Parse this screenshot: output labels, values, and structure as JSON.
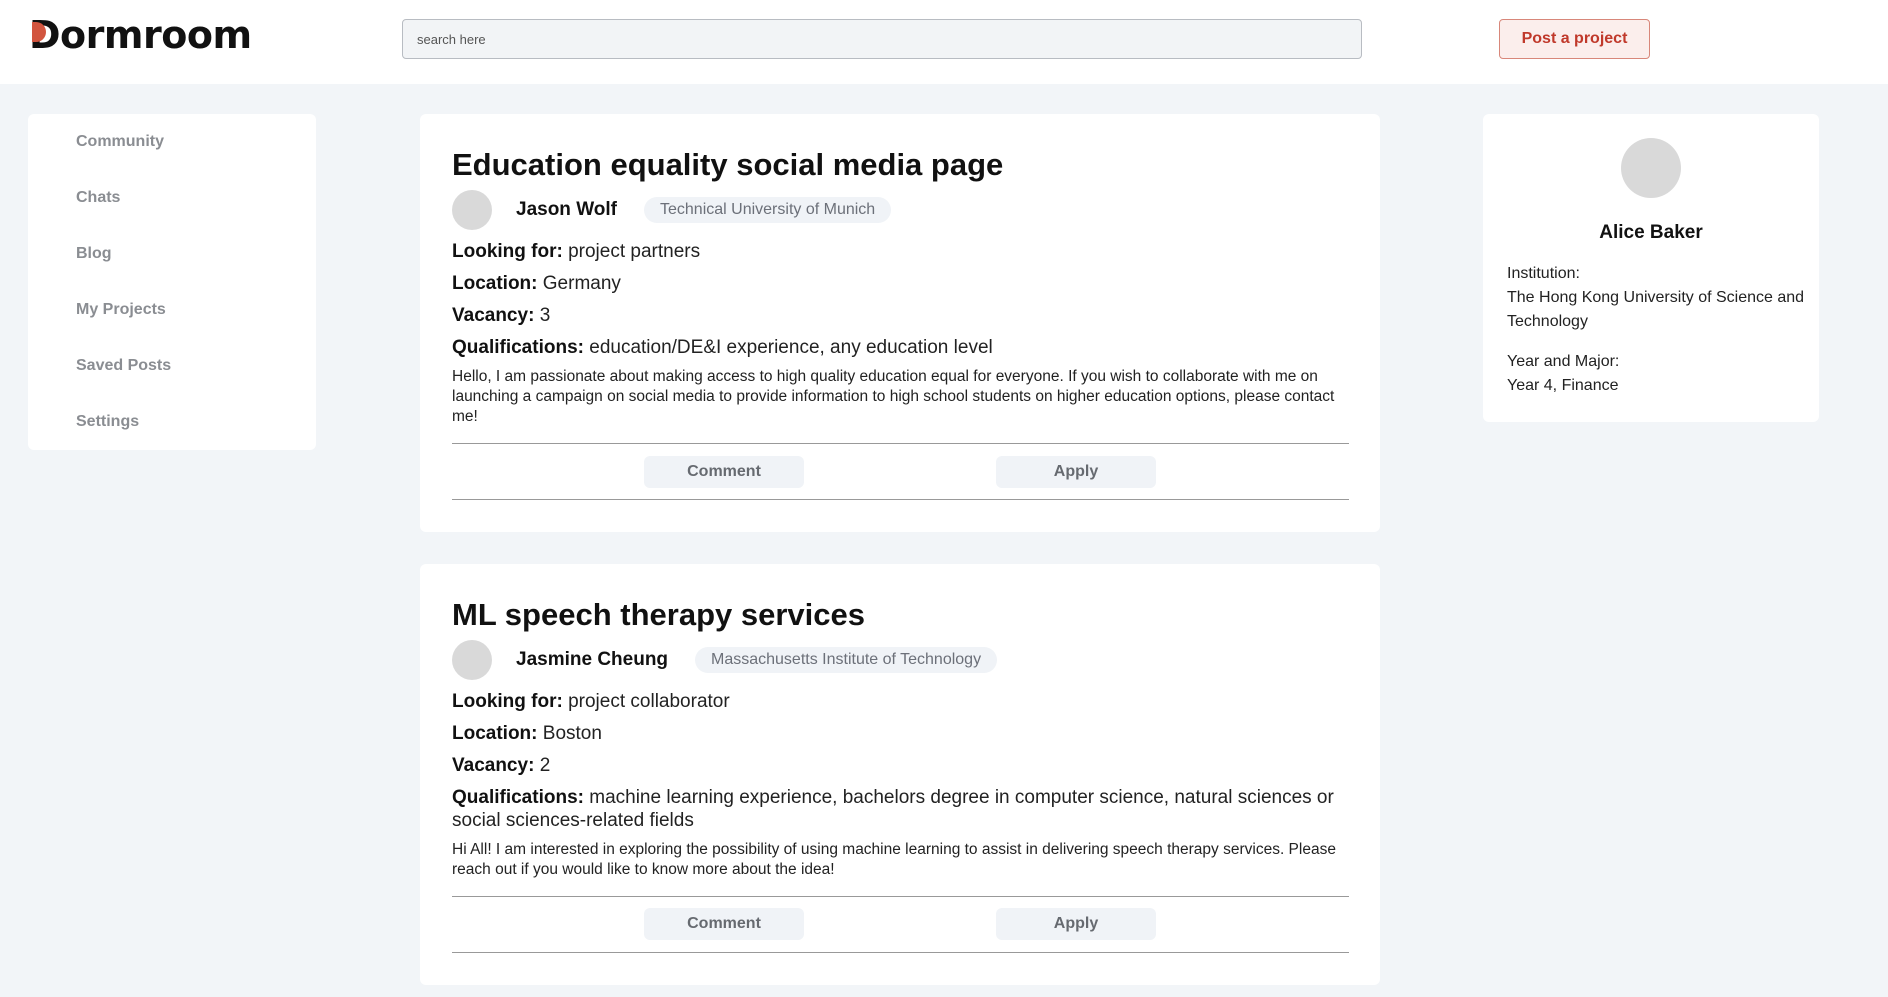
{
  "header": {
    "logo_text": "ormroom",
    "logo_first_letter": "D",
    "search_placeholder": "search here",
    "post_button": "Post a project",
    "accent_color": "#d2553f"
  },
  "sidebar": {
    "items": [
      {
        "label": "Community"
      },
      {
        "label": "Chats"
      },
      {
        "label": "Blog"
      },
      {
        "label": "My Projects"
      },
      {
        "label": "Saved Posts"
      },
      {
        "label": "Settings"
      }
    ]
  },
  "posts": [
    {
      "title": "Education equality social media page",
      "author": "Jason Wolf",
      "university": "Technical University of Munich",
      "looking_for_label": "Looking for:",
      "looking_for": "project partners",
      "location_label": "Location:",
      "location": "Germany",
      "vacancy_label": "Vacancy:",
      "vacancy": "3",
      "qualifications_label": "Qualifications:",
      "qualifications": "education/DE&I experience, any education level",
      "description": "Hello, I am passionate about making access to high quality education equal for everyone. If you wish to collaborate with me on launching a campaign on social media to provide information to high school students on higher education options, please contact me!",
      "comment_label": "Comment",
      "apply_label": "Apply"
    },
    {
      "title": "ML speech therapy services",
      "author": "Jasmine Cheung",
      "university": "Massachusetts Institute of Technology",
      "looking_for_label": "Looking for:",
      "looking_for": "project collaborator",
      "location_label": "Location:",
      "location": "Boston",
      "vacancy_label": "Vacancy:",
      "vacancy": "2",
      "qualifications_label": "Qualifications:",
      "qualifications": "machine learning experience, bachelors degree in computer science, natural sciences or social sciences-related fields",
      "description": "Hi All! I am interested in exploring the possibility of using machine learning to assist in delivering speech therapy services. Please reach out if you would like to know more about the idea!",
      "comment_label": "Comment",
      "apply_label": "Apply"
    }
  ],
  "profile": {
    "name": "Alice Baker",
    "institution_label": "Institution:",
    "institution": "The Hong Kong University of Science and Technology",
    "year_major_label": "Year and Major:",
    "year_major": "Year 4, Finance"
  }
}
